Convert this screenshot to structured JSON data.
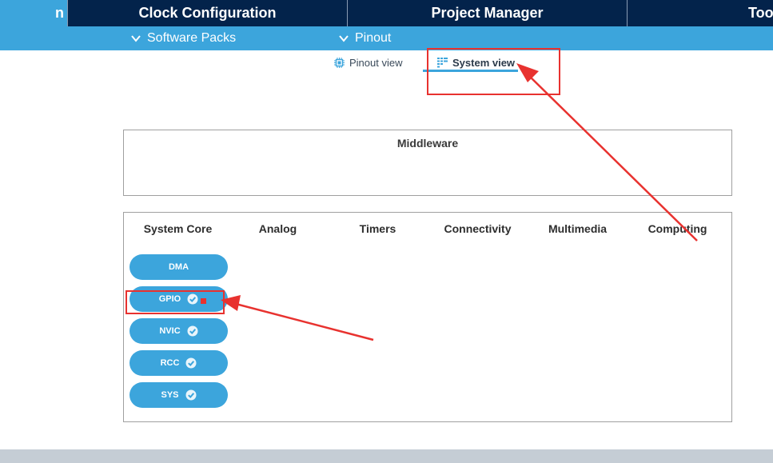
{
  "top_tabs": {
    "active_partial": "n",
    "clock": "Clock Configuration",
    "project": "Project Manager",
    "tools": "Tools"
  },
  "sub_menu": {
    "software_packs": "Software Packs",
    "pinout": "Pinout"
  },
  "view_tabs": {
    "pinout_view": "Pinout view",
    "system_view": "System view"
  },
  "middleware": {
    "title": "Middleware"
  },
  "categories": [
    "System Core",
    "Analog",
    "Timers",
    "Connectivity",
    "Multimedia",
    "Computing"
  ],
  "system_core_items": [
    {
      "label": "DMA",
      "configured": false
    },
    {
      "label": "GPIO",
      "configured": true
    },
    {
      "label": "NVIC",
      "configured": true
    },
    {
      "label": "RCC",
      "configured": true
    },
    {
      "label": "SYS",
      "configured": true
    }
  ],
  "colors": {
    "navy": "#03234b",
    "accent_blue": "#3ca5dc",
    "annotation_red": "#e8322f",
    "check_green": "#3ca5dc"
  }
}
